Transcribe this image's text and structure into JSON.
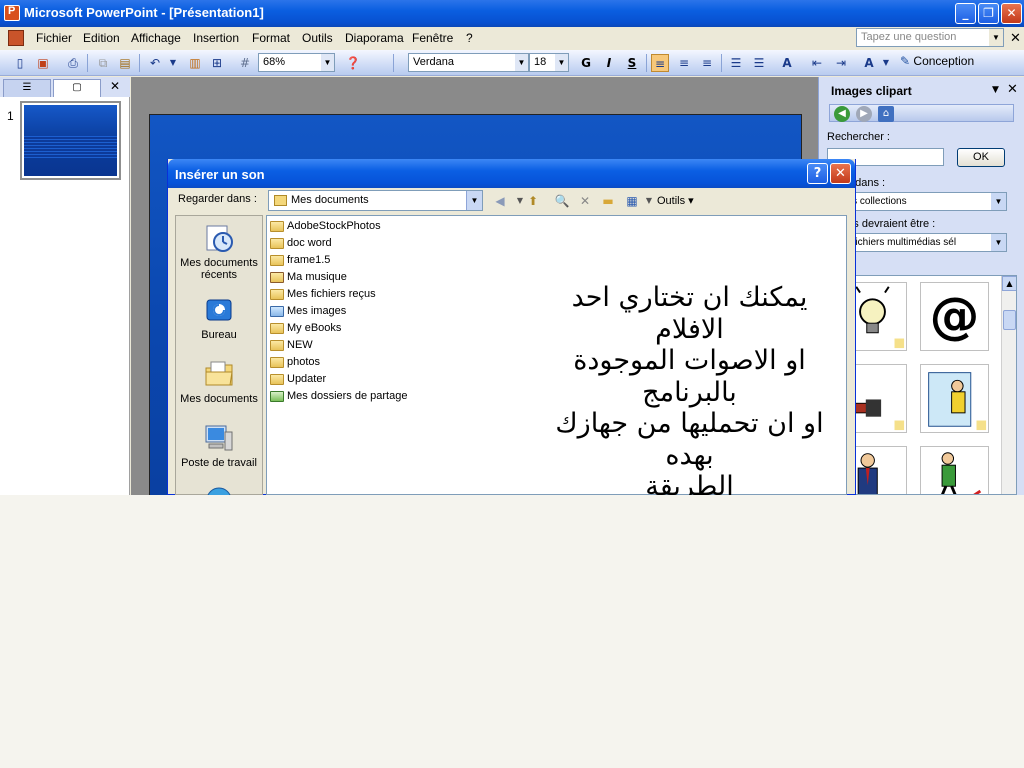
{
  "window": {
    "title": "Microsoft PowerPoint - [Présentation1]",
    "controls": [
      "minimize",
      "maximize",
      "close"
    ]
  },
  "menubar": {
    "items": [
      "Fichier",
      "Edition",
      "Affichage",
      "Insertion",
      "Format",
      "Outils",
      "Diaporama",
      "Fenêtre",
      "?"
    ],
    "help_placeholder": "Tapez une question"
  },
  "toolbar": {
    "zoom": "68%",
    "font": "Verdana",
    "font_size": "18",
    "bold": "G",
    "italic": "I",
    "shadow": "S",
    "design_label": "Conception"
  },
  "leftpane": {
    "slide_number": "1"
  },
  "taskpane": {
    "title": "Images clipart",
    "search_label": "Rechercher :",
    "search_value": "",
    "ok_label": "OK",
    "search_in_label": "rcher dans :",
    "search_in_value": "es les collections",
    "results_label": "sultats devraient être :",
    "results_value": "s de fichiers multimédias sél",
    "clips": [
      "lightbulb-clipart",
      "at-sign-clipart",
      "chainsaw-clipart",
      "window-cleaner-clipart",
      "businessman-clipart",
      "walking-man-clipart"
    ]
  },
  "dialog": {
    "title": "Insérer un son",
    "look_in_label": "Regarder dans :",
    "look_in_value": "Mes documents",
    "tools_label": "Outils",
    "places": [
      "Mes documents récents",
      "Bureau",
      "Mes documents",
      "Poste de travail"
    ],
    "files": [
      {
        "name": "AdobeStockPhotos",
        "icon": "folder-icon"
      },
      {
        "name": "doc word",
        "icon": "folder-icon"
      },
      {
        "name": "frame1.5",
        "icon": "folder-icon"
      },
      {
        "name": "Ma musique",
        "icon": "music-folder-icon"
      },
      {
        "name": "Mes fichiers reçus",
        "icon": "folder-icon"
      },
      {
        "name": "Mes images",
        "icon": "pictures-folder-icon"
      },
      {
        "name": "My eBooks",
        "icon": "folder-icon"
      },
      {
        "name": "NEW",
        "icon": "folder-icon"
      },
      {
        "name": "photos",
        "icon": "folder-icon"
      },
      {
        "name": "Updater",
        "icon": "folder-icon"
      },
      {
        "name": "Mes dossiers de partage",
        "icon": "shared-folder-icon"
      }
    ],
    "annotation_lines": [
      "يمكنك ان تختاري احد الافلام",
      "او الاصوات الموجودة بالبرنامج",
      "او ان تحمليها من جهازك بهده",
      "الطريقة"
    ]
  },
  "colors": {
    "titlebar": "#0a5ee0",
    "close_button": "#c2391a",
    "slide_blue": "#0b48b0",
    "workspace_gray": "#8a8a8a",
    "chrome": "#ece9d8",
    "taskpane": "#d6dff5"
  }
}
